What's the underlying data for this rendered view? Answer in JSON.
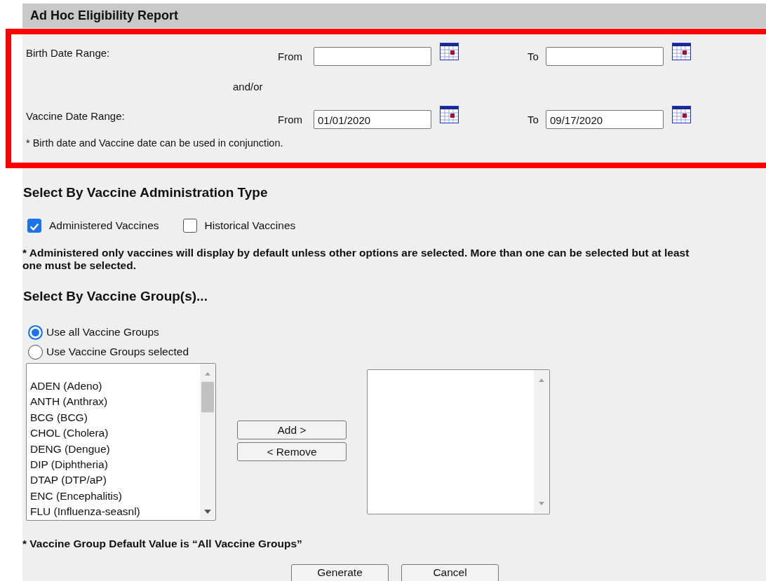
{
  "title": "Ad Hoc Eligibility Report",
  "date_ranges": [
    {
      "label": "Birth Date Range:",
      "from": {
        "label": "From"
      },
      "to": {
        "label": "To"
      }
    },
    {
      "label": "Vaccine Date Range:",
      "from": {
        "label": "From",
        "value": "01/01/2020"
      },
      "to": {
        "label": "To",
        "value": "09/17/2020"
      }
    }
  ],
  "date_connector": "and/or",
  "date_note": "* Birth date and Vaccine date can be used in conjunction.",
  "administration_heading": "Select By Vaccine Administration Type",
  "administration_types": [
    {
      "label": "Administered Vaccines",
      "checked": true
    },
    {
      "label": "Historical Vaccines",
      "checked": false
    }
  ],
  "administration_note": "* Administered only vaccines will display by default unless other options are selected. More than one can be selected but at least one must be selected.",
  "group_heading": "Select By Vaccine Group(s)...",
  "group_modes": [
    {
      "label": "Use all Vaccine Groups",
      "selected": true
    },
    {
      "label": "Use Vaccine Groups selected",
      "selected": false
    }
  ],
  "available_groups": [
    "ADEN (Adeno)",
    "ANTH (Anthrax)",
    "BCG (BCG)",
    "CHOL (Cholera)",
    "DENG (Dengue)",
    "DIP (Diphtheria)",
    "DTAP (DTP/aP)",
    "ENC (Encephalitis)",
    "FLU (Influenza-seasnl)"
  ],
  "transfer_buttons": [
    "Add >",
    "< Remove"
  ],
  "group_note": "* Vaccine Group Default Value is “All Vaccine Groups”",
  "actions": [
    "Generate",
    "Cancel"
  ]
}
